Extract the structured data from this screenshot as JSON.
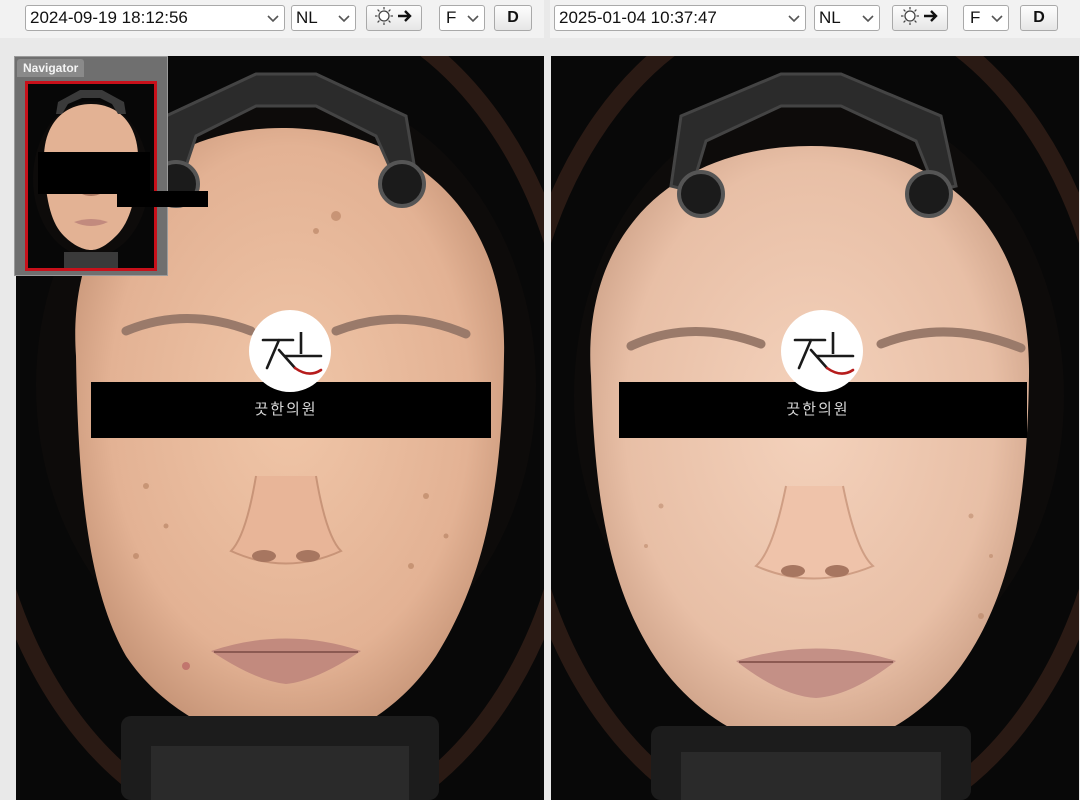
{
  "left_panel": {
    "datetime": "2024-09-19 18:12:56",
    "mode": "NL",
    "light_icon": "sun-arrow-icon",
    "view": "F",
    "d_label": "D",
    "navigator": {
      "title": "Navigator"
    },
    "watermark": {
      "clinic_name": "끗한의원"
    }
  },
  "right_panel": {
    "datetime": "2025-01-04 10:37:47",
    "mode": "NL",
    "light_icon": "sun-arrow-icon",
    "view": "F",
    "d_label": "D",
    "watermark": {
      "clinic_name": "끗한의원"
    }
  },
  "colors": {
    "skin": "#e8b898",
    "skin_shadow": "#c9967a",
    "background": "#080808",
    "navigator_border": "#c8101a"
  }
}
